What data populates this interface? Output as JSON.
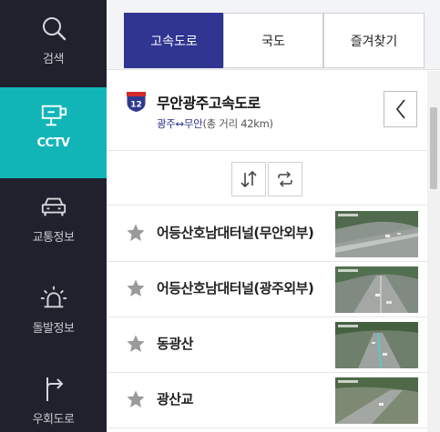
{
  "sidebar": {
    "items": [
      {
        "label": "검색",
        "icon": "search-icon"
      },
      {
        "label": "CCTV",
        "icon": "cctv-icon"
      },
      {
        "label": "교통정보",
        "icon": "car-icon"
      },
      {
        "label": "돌발정보",
        "icon": "alert-light-icon"
      },
      {
        "label": "우회도로",
        "icon": "detour-arrow-icon"
      }
    ],
    "active_index": 1
  },
  "tabs": [
    {
      "label": "고속도로"
    },
    {
      "label": "국도"
    },
    {
      "label": "즐겨찾기"
    }
  ],
  "route": {
    "number": "12",
    "name": "무안광주고속도로",
    "section": "광주↔무안",
    "distance": "(총 거리 42km)"
  },
  "cctv_list": [
    {
      "name": "어등산호남대터널(무안외부)"
    },
    {
      "name": "어등산호남대터널(광주외부)"
    },
    {
      "name": "동광산"
    },
    {
      "name": "광산교"
    }
  ],
  "colors": {
    "sidebar_bg": "#21212d",
    "active_accent": "#11b5b8",
    "tab_active": "#2f3590",
    "star": "#9a9a9a"
  }
}
